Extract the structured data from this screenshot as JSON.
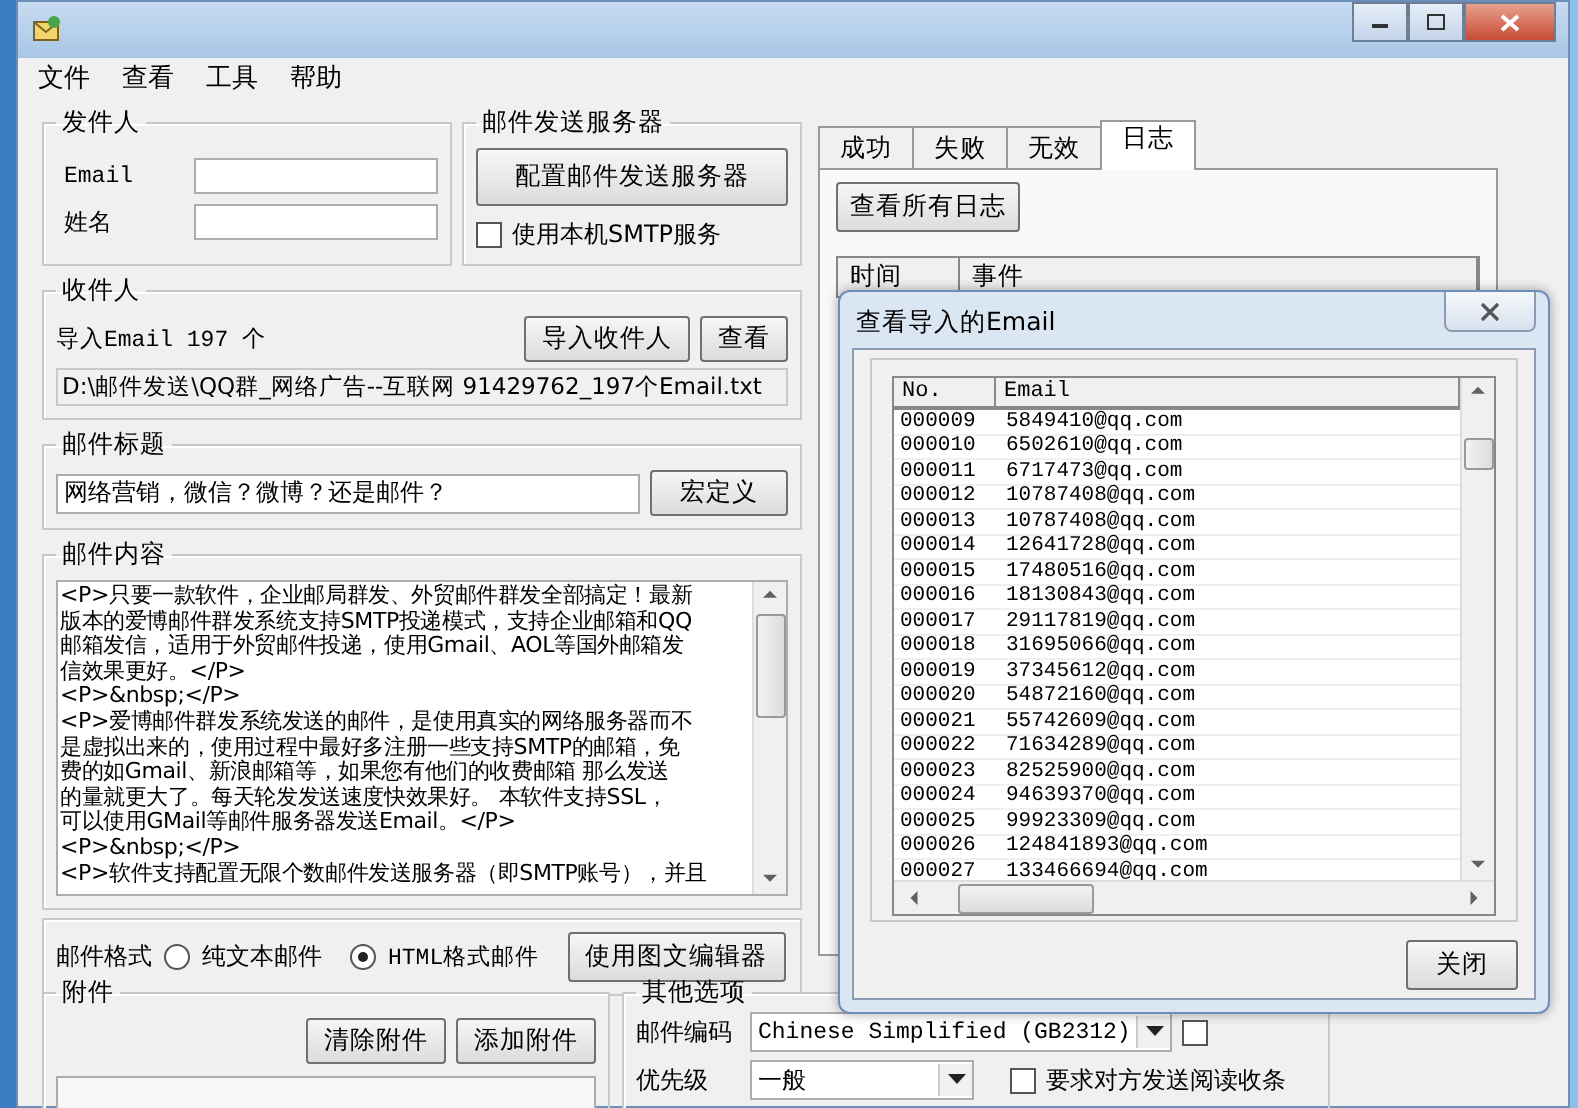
{
  "menu": [
    "文件",
    "查看",
    "工具",
    "帮助"
  ],
  "sender": {
    "title": "发件人",
    "fields": [
      {
        "label": "Email"
      },
      {
        "label": "姓名"
      }
    ]
  },
  "server": {
    "title": "邮件发送服务器",
    "button": "配置邮件发送服务器",
    "checkbox": {
      "label": "使用本机SMTP服务",
      "checked": false
    }
  },
  "recipients": {
    "title": "收件人",
    "count": "导入Email 197 个",
    "buttons": [
      "导入收件人",
      "查看"
    ],
    "path": "D:\\邮件发送\\QQ群_网络广告--互联网 91429762_197个Email.txt"
  },
  "subject": {
    "title": "邮件标题",
    "value": "网络营销，微信？微博？还是邮件？",
    "button": "宏定义"
  },
  "content": {
    "title": "邮件内容",
    "lines": [
      "<P>只要一款软件，企业邮局群发、外贸邮件群发全部搞定！最新",
      "版本的爱博邮件群发系统支持SMTP投递模式，支持企业邮箱和QQ",
      "邮箱发信，适用于外贸邮件投递，使用Gmail、AOL等国外邮箱发",
      "信效果更好。</P>",
      "<P>&nbsp;</P>",
      "<P>爱博邮件群发系统发送的邮件，是使用真实的网络服务器而不",
      "是虚拟出来的，使用过程中最好多注册一些支持SMTP的邮箱，免",
      "费的如Gmail、新浪邮箱等，如果您有他们的收费邮箱 那么发送",
      "的量就更大了。每天轮发发送速度快效果好。 本软件支持SSL，",
      "可以使用GMail等邮件服务器发送Email。</P>",
      "<P>&nbsp;</P>",
      "<P>软件支持配置无限个数邮件发送服务器（即SMTP账号），并且"
    ]
  },
  "format": {
    "label": "邮件格式",
    "options": [
      {
        "label": "纯文本邮件",
        "selected": false
      },
      {
        "label": "HTML格式邮件",
        "selected": true
      }
    ],
    "button": "使用图文编辑器"
  },
  "attachments": {
    "title": "附件",
    "buttons": [
      "清除附件",
      "添加附件"
    ]
  },
  "other": {
    "title": "其他选项",
    "encoding_label": "邮件编码",
    "encoding": "Chinese Simplified (GB2312)",
    "encoding_check": {
      "checked": false
    },
    "priority_label": "优先级",
    "priority": "一般",
    "receipt": {
      "label": "要求对方发送阅读收条",
      "checked": false
    }
  },
  "tabs": [
    {
      "label": "成功",
      "selected": false
    },
    {
      "label": "失败",
      "selected": false
    },
    {
      "label": "无效",
      "selected": false
    },
    {
      "label": "日志",
      "selected": true
    }
  ],
  "log": {
    "button": "查看所有日志",
    "columns": [
      "时间",
      "事件"
    ]
  },
  "dialog": {
    "title": "查看导入的Email",
    "columns": [
      "No.",
      "Email"
    ],
    "button": "关闭",
    "rows": [
      [
        "000009",
        "5849410@qq.com"
      ],
      [
        "000010",
        "6502610@qq.com"
      ],
      [
        "000011",
        "6717473@qq.com"
      ],
      [
        "000012",
        "10787408@qq.com"
      ],
      [
        "000013",
        "10787408@qq.com"
      ],
      [
        "000014",
        "12641728@qq.com"
      ],
      [
        "000015",
        "17480516@qq.com"
      ],
      [
        "000016",
        "18130843@qq.com"
      ],
      [
        "000017",
        "29117819@qq.com"
      ],
      [
        "000018",
        "31695066@qq.com"
      ],
      [
        "000019",
        "37345612@qq.com"
      ],
      [
        "000020",
        "54872160@qq.com"
      ],
      [
        "000021",
        "55742609@qq.com"
      ],
      [
        "000022",
        "71634289@qq.com"
      ],
      [
        "000023",
        "82525900@qq.com"
      ],
      [
        "000024",
        "94639370@qq.com"
      ],
      [
        "000025",
        "99923309@qq.com"
      ],
      [
        "000026",
        "124841893@qq.com"
      ],
      [
        "000027",
        "133466694@qq.com"
      ]
    ]
  }
}
